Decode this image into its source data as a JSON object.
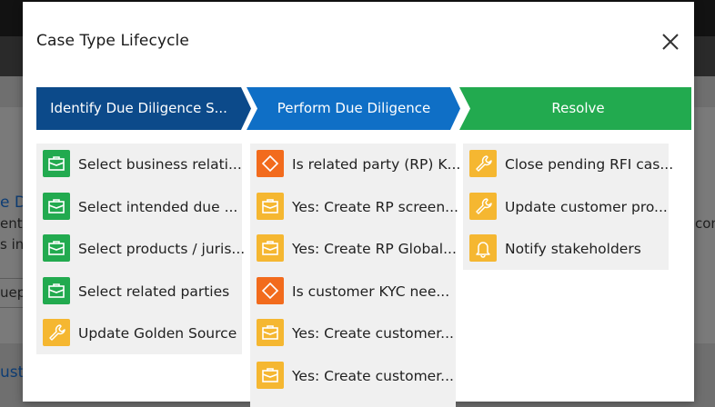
{
  "background": {
    "fragments": [
      {
        "id": "frag-1",
        "text": "e D"
      },
      {
        "id": "frag-2",
        "text": "ent"
      },
      {
        "id": "frag-3",
        "text": "s in"
      },
      {
        "id": "frag-4",
        "text": "uep"
      },
      {
        "id": "frag-5",
        "text": "ust"
      },
      {
        "id": "frag-6",
        "text": "con"
      }
    ]
  },
  "modal": {
    "title": "Case Type Lifecycle",
    "close_icon": "close-icon"
  },
  "stages": [
    {
      "label": "Identify Due Diligence S...",
      "color": "#0c4a8a"
    },
    {
      "label": "Perform Due Diligence",
      "color": "#0f6fc6"
    },
    {
      "label": "Resolve",
      "color": "#22aa4f"
    }
  ],
  "columns": [
    {
      "steps": [
        {
          "label": "Select business relati...",
          "icon": "briefcase-icon",
          "color": "#22aa4f"
        },
        {
          "label": "Select intended due ...",
          "icon": "briefcase-icon",
          "color": "#22aa4f"
        },
        {
          "label": "Select products / juris...",
          "icon": "briefcase-icon",
          "color": "#22aa4f"
        },
        {
          "label": "Select related parties",
          "icon": "briefcase-icon",
          "color": "#22aa4f"
        },
        {
          "label": "Update Golden Source",
          "icon": "wrench-icon",
          "color": "#f5b731"
        }
      ]
    },
    {
      "steps": [
        {
          "label": "Is related party (RP) K...",
          "icon": "decision-diamond-icon",
          "color": "#f26b1d"
        },
        {
          "label": "Yes: Create RP screen...",
          "icon": "briefcase-icon",
          "color": "#f5b731"
        },
        {
          "label": "Yes: Create RP Global...",
          "icon": "briefcase-icon",
          "color": "#f5b731"
        },
        {
          "label": "Is customer KYC nee...",
          "icon": "decision-diamond-icon",
          "color": "#f26b1d"
        },
        {
          "label": "Yes: Create customer...",
          "icon": "briefcase-icon",
          "color": "#f5b731"
        },
        {
          "label": "Yes: Create customer...",
          "icon": "briefcase-icon",
          "color": "#f5b731"
        }
      ]
    },
    {
      "steps": [
        {
          "label": "Close pending RFI cas...",
          "icon": "wrench-icon",
          "color": "#f5b731"
        },
        {
          "label": "Update customer pro...",
          "icon": "wrench-icon",
          "color": "#f5b731"
        },
        {
          "label": "Notify stakeholders",
          "icon": "bell-icon",
          "color": "#f5b731"
        }
      ]
    }
  ]
}
